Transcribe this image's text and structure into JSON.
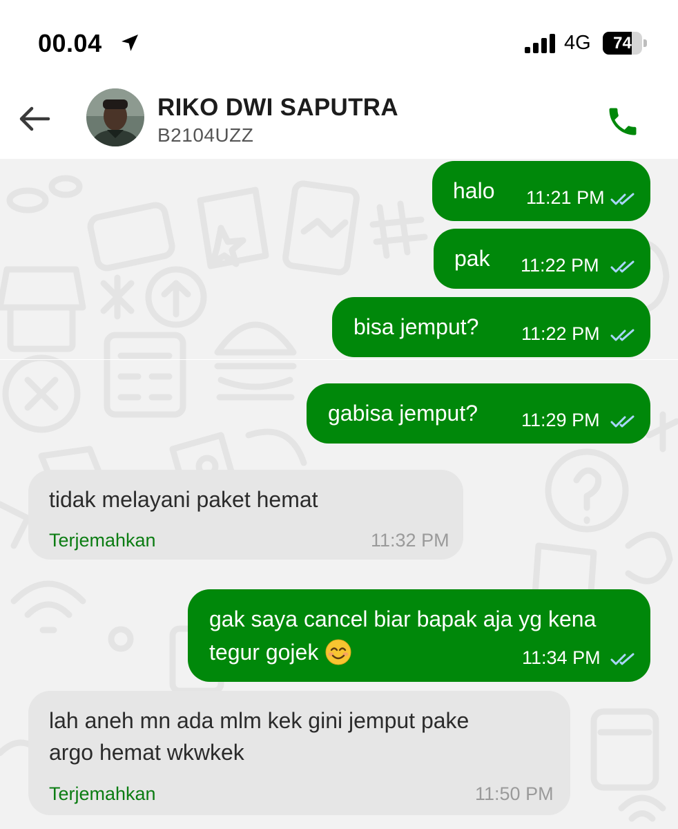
{
  "status_bar": {
    "time": "00.04",
    "network": "4G",
    "battery_level": "74",
    "icons": [
      "location-arrow-icon",
      "signal-bars-icon",
      "battery-icon"
    ]
  },
  "header": {
    "contact_name": "RIKO DWI SAPUTRA",
    "plate_number": "B2104UZZ",
    "icons": [
      "back-arrow-icon",
      "phone-call-icon"
    ],
    "accent_color": "#00880a"
  },
  "messages": [
    {
      "direction": "outgoing",
      "text": "halo",
      "time": "11:21 PM",
      "status": "read"
    },
    {
      "direction": "outgoing",
      "text": "pak",
      "time": "11:22 PM",
      "status": "read"
    },
    {
      "direction": "outgoing",
      "text": "bisa jemput?",
      "time": "11:22 PM",
      "status": "read"
    },
    {
      "direction": "outgoing",
      "text": "gabisa jemput?",
      "time": "11:29 PM",
      "status": "read"
    },
    {
      "direction": "incoming",
      "text": "tidak melayani paket hemat",
      "time": "11:32 PM",
      "action": "Terjemahkan"
    },
    {
      "direction": "outgoing",
      "lines": [
        "gak saya cancel biar bapak aja yg kena",
        "tegur gojek"
      ],
      "emoji": "smiling-face-emoji",
      "time": "11:34 PM",
      "status": "read"
    },
    {
      "direction": "incoming",
      "lines": [
        "lah aneh mn ada mlm kek gini jemput pake",
        "argo hemat wkwkek"
      ],
      "time": "11:50 PM",
      "action": "Terjemahkan"
    }
  ],
  "colors": {
    "outgoing_bubble": "#00880a",
    "incoming_bubble": "#e6e6e6",
    "chat_background": "#f2f2f2",
    "read_tick": "#a9d6ff"
  }
}
